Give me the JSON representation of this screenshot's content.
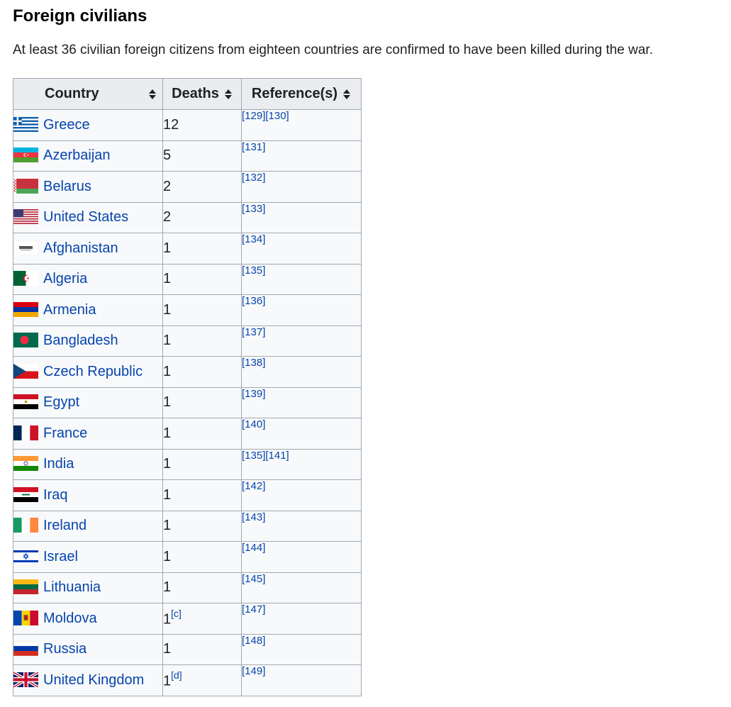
{
  "section": {
    "title": "Foreign civilians",
    "intro": "At least 36 civilian foreign citizens from eighteen countries are confirmed to have been killed during the war."
  },
  "table": {
    "headers": [
      "Country",
      "Deaths",
      "Reference(s)"
    ],
    "rows": [
      {
        "country": "Greece",
        "flag": "greece-flag-icon",
        "deaths": "12",
        "note": "",
        "refs": "[129][130]"
      },
      {
        "country": "Azerbaijan",
        "flag": "azerbaijan-flag-icon",
        "deaths": "5",
        "note": "",
        "refs": "[131]"
      },
      {
        "country": "Belarus",
        "flag": "belarus-flag-icon",
        "deaths": "2",
        "note": "",
        "refs": "[132]"
      },
      {
        "country": "United States",
        "flag": "united-states-flag-icon",
        "deaths": "2",
        "note": "",
        "refs": "[133]"
      },
      {
        "country": "Afghanistan",
        "flag": "afghanistan-flag-icon",
        "deaths": "1",
        "note": "",
        "refs": "[134]"
      },
      {
        "country": "Algeria",
        "flag": "algeria-flag-icon",
        "deaths": "1",
        "note": "",
        "refs": "[135]"
      },
      {
        "country": "Armenia",
        "flag": "armenia-flag-icon",
        "deaths": "1",
        "note": "",
        "refs": "[136]"
      },
      {
        "country": "Bangladesh",
        "flag": "bangladesh-flag-icon",
        "deaths": "1",
        "note": "",
        "refs": "[137]"
      },
      {
        "country": "Czech Republic",
        "flag": "czech-republic-flag-icon",
        "deaths": "1",
        "note": "",
        "refs": "[138]"
      },
      {
        "country": "Egypt",
        "flag": "egypt-flag-icon",
        "deaths": "1",
        "note": "",
        "refs": "[139]"
      },
      {
        "country": "France",
        "flag": "france-flag-icon",
        "deaths": "1",
        "note": "",
        "refs": "[140]"
      },
      {
        "country": "India",
        "flag": "india-flag-icon",
        "deaths": "1",
        "note": "",
        "refs": "[135][141]"
      },
      {
        "country": "Iraq",
        "flag": "iraq-flag-icon",
        "deaths": "1",
        "note": "",
        "refs": "[142]"
      },
      {
        "country": "Ireland",
        "flag": "ireland-flag-icon",
        "deaths": "1",
        "note": "",
        "refs": "[143]"
      },
      {
        "country": "Israel",
        "flag": "israel-flag-icon",
        "deaths": "1",
        "note": "",
        "refs": "[144]"
      },
      {
        "country": "Lithuania",
        "flag": "lithuania-flag-icon",
        "deaths": "1",
        "note": "",
        "refs": "[145]"
      },
      {
        "country": "Moldova",
        "flag": "moldova-flag-icon",
        "deaths": "1",
        "note": "[c]",
        "refs": "[147]"
      },
      {
        "country": "Russia",
        "flag": "russia-flag-icon",
        "deaths": "1",
        "note": "",
        "refs": "[148]"
      },
      {
        "country": "United Kingdom",
        "flag": "united-kingdom-flag-icon",
        "deaths": "1",
        "note": "[d]",
        "refs": "[149]"
      }
    ]
  },
  "colors": {
    "link": "#0645ad",
    "header_bg": "#eaecf0",
    "cell_bg": "#f8f9fa",
    "border": "#a2a9b1"
  }
}
